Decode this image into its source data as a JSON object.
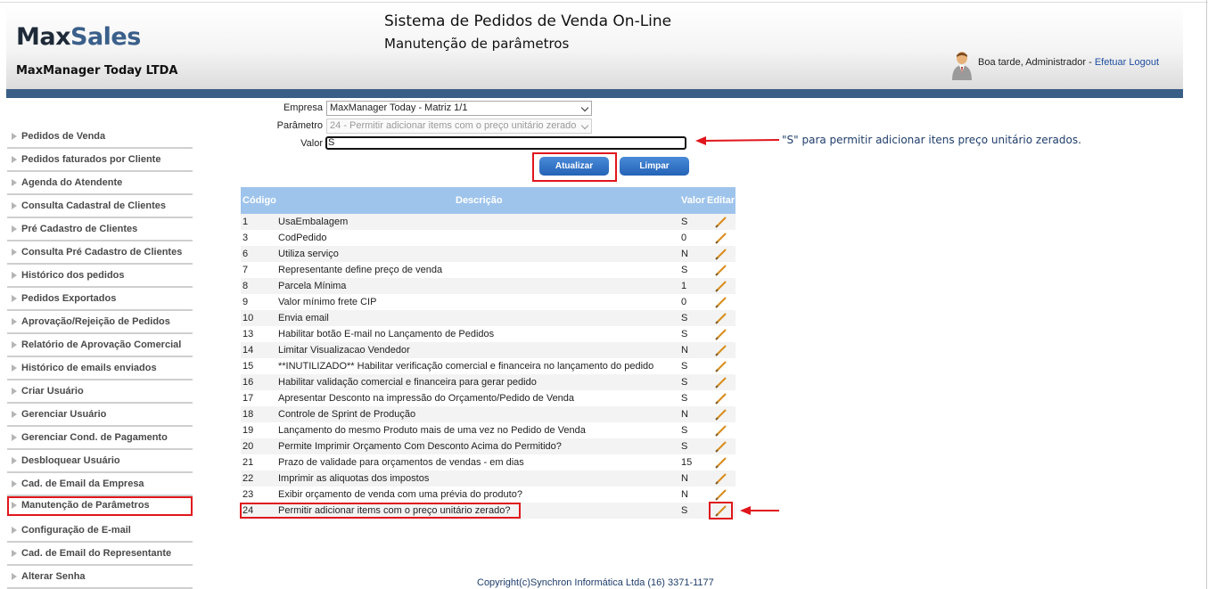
{
  "header": {
    "logo_max": "Max",
    "logo_sales": "Sales",
    "company": "MaxManager Today LTDA",
    "title": "Sistema de Pedidos de Venda On-Line",
    "subtitle": "Manutenção de parâmetros",
    "greeting": "Boa tarde, Administrador - ",
    "logout": "Efetuar Logout"
  },
  "sidebar": {
    "items": [
      {
        "label": "Pedidos de Venda"
      },
      {
        "label": "Pedidos faturados por Cliente"
      },
      {
        "label": "Agenda do Atendente"
      },
      {
        "label": "Consulta Cadastral de Clientes"
      },
      {
        "label": "Pré Cadastro de Clientes"
      },
      {
        "label": "Consulta Pré Cadastro de Clientes"
      },
      {
        "label": "Histórico dos pedidos"
      },
      {
        "label": "Pedidos Exportados"
      },
      {
        "label": "Aprovação/Rejeição de Pedidos"
      },
      {
        "label": "Relatório de Aprovação Comercial"
      },
      {
        "label": "Histórico de emails enviados"
      },
      {
        "label": "Criar Usuário"
      },
      {
        "label": "Gerenciar Usuário"
      },
      {
        "label": "Gerenciar Cond. de Pagamento"
      },
      {
        "label": "Desbloquear Usuário"
      },
      {
        "label": "Cad. de Email da Empresa"
      },
      {
        "label": "Manutenção de Parâmetros",
        "active": true
      },
      {
        "label": "Configuração de E-mail"
      },
      {
        "label": "Cad. de Email do Representante"
      },
      {
        "label": "Alterar Senha"
      }
    ]
  },
  "form": {
    "empresa_label": "Empresa",
    "empresa_value": "MaxManager Today - Matriz 1/1",
    "parametro_label": "Parâmetro",
    "parametro_value": "24 - Permitir adicionar items com o preço unitário zerado",
    "valor_label": "Valor",
    "valor_value": "S",
    "atualizar": "Atualizar",
    "limpar": "Limpar"
  },
  "annotation": "\"S\" para permitir adicionar itens preço unitário zerados.",
  "table": {
    "headers": {
      "code": "Código",
      "desc": "Descrição",
      "value": "Valor",
      "edit": "Editar"
    },
    "rows": [
      {
        "code": "1",
        "desc": "UsaEmbalagem",
        "value": "S"
      },
      {
        "code": "3",
        "desc": "CodPedido",
        "value": "0"
      },
      {
        "code": "6",
        "desc": "Utiliza serviço",
        "value": "N"
      },
      {
        "code": "7",
        "desc": "Representante define preço de venda",
        "value": "S"
      },
      {
        "code": "8",
        "desc": "Parcela Mínima",
        "value": "1"
      },
      {
        "code": "9",
        "desc": "Valor mínimo frete CIP",
        "value": "0"
      },
      {
        "code": "10",
        "desc": "Envia email",
        "value": "S"
      },
      {
        "code": "13",
        "desc": "Habilitar botão E-mail no Lançamento de Pedidos",
        "value": "S"
      },
      {
        "code": "14",
        "desc": "Limitar Visualizacao Vendedor",
        "value": "N"
      },
      {
        "code": "15",
        "desc": "**INUTILIZADO** Habilitar verificação comercial e financeira no lançamento do pedido",
        "value": "S"
      },
      {
        "code": "16",
        "desc": "Habilitar validação comercial e financeira para gerar pedido",
        "value": "S"
      },
      {
        "code": "17",
        "desc": "Apresentar Desconto na impressão do Orçamento/Pedido de Venda",
        "value": "S"
      },
      {
        "code": "18",
        "desc": "Controle de Sprint de Produção",
        "value": "N"
      },
      {
        "code": "19",
        "desc": "Lançamento do mesmo Produto mais de uma vez no Pedido de Venda",
        "value": "S"
      },
      {
        "code": "20",
        "desc": "Permite Imprimir Orçamento Com Desconto Acima do Permitido?",
        "value": "S"
      },
      {
        "code": "21",
        "desc": "Prazo de validade para orçamentos de vendas - em dias",
        "value": "15"
      },
      {
        "code": "22",
        "desc": "Imprimir as aliquotas dos impostos",
        "value": "N"
      },
      {
        "code": "23",
        "desc": "Exibir orçamento de venda com uma prévia do produto?",
        "value": "N"
      },
      {
        "code": "24",
        "desc": "Permitir adicionar items com o preço unitário zerado?",
        "value": "S"
      }
    ]
  },
  "footer": "Copyright(c)Synchron Informática Ltda (16) 3371-1177",
  "colors": {
    "header_bar": "#3a5f86",
    "table_header": "#9fc4ec",
    "button": "#2f6fc4",
    "highlight": "#e0161c"
  }
}
